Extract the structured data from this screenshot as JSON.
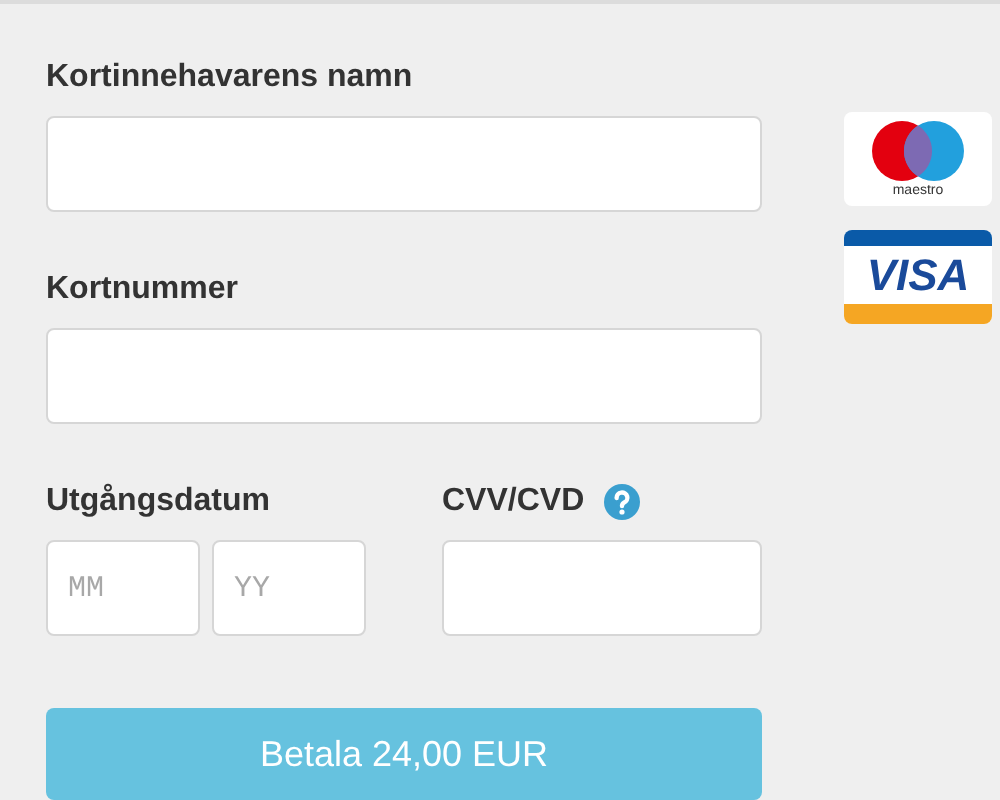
{
  "cardholder": {
    "label": "Kortinnehavarens namn"
  },
  "card_number": {
    "label": "Kortnummer"
  },
  "expiry": {
    "label": "Utgångsdatum",
    "month_placeholder": "MM",
    "year_placeholder": "YY"
  },
  "cvv": {
    "label": "CVV/CVD"
  },
  "pay_button": "Betala 24,00 EUR",
  "card_logos": [
    {
      "kind": "maestro",
      "text": "maestro"
    },
    {
      "kind": "visa",
      "text": "VISA"
    }
  ]
}
